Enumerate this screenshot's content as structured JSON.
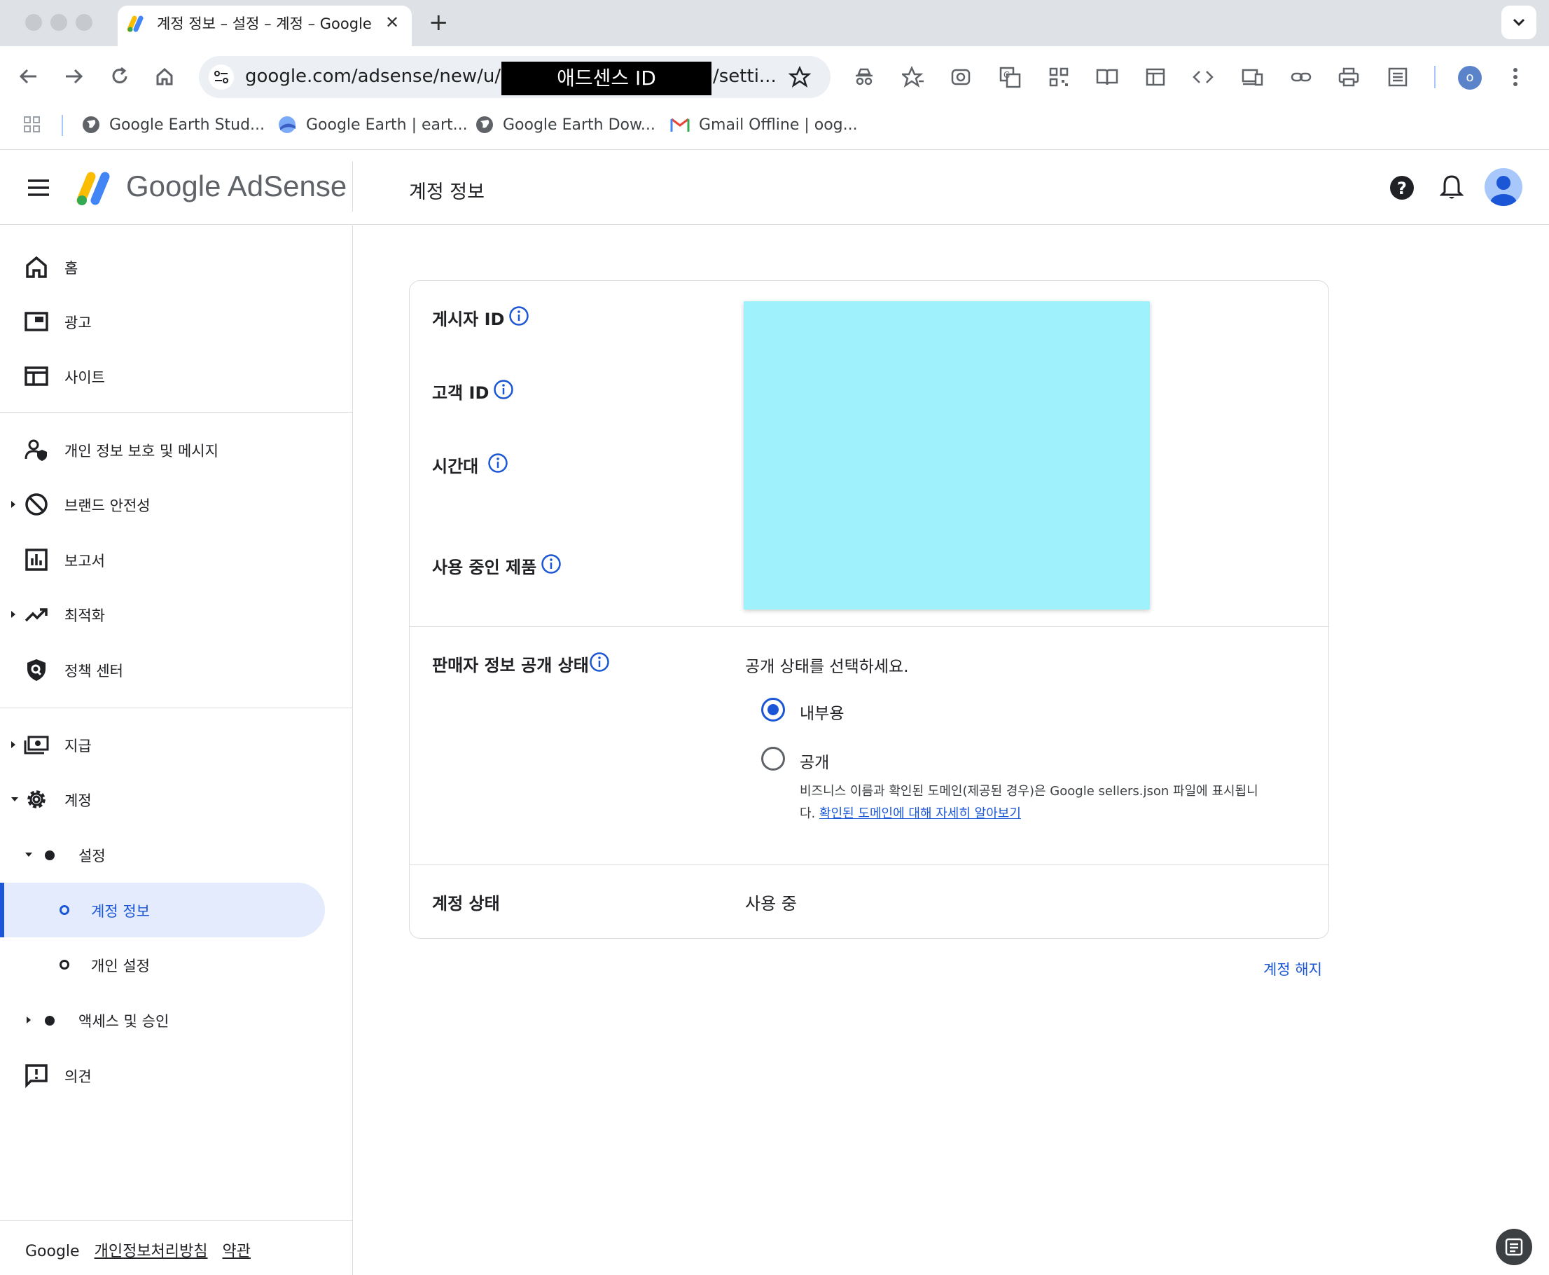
{
  "browser": {
    "tab_title": "계정 정보 – 설정 – 계정 – Google",
    "url_left": "google.com/adsense/new/u/0/",
    "url_redaction_label": "애드센스 ID",
    "url_right": "/setti...",
    "profile_initial": "o",
    "bookmarks": [
      {
        "label": "Google Earth Stud..."
      },
      {
        "label": "Google Earth | eart..."
      },
      {
        "label": "Google Earth Dow..."
      },
      {
        "label": "Gmail Offline | oog..."
      }
    ]
  },
  "header": {
    "logo_text": "Google AdSense",
    "page_title": "계정 정보"
  },
  "sidebar": {
    "items": [
      {
        "label": "홈"
      },
      {
        "label": "광고"
      },
      {
        "label": "사이트"
      },
      {
        "label": "개인 정보 보호 및 메시지"
      },
      {
        "label": "브랜드 안전성"
      },
      {
        "label": "보고서"
      },
      {
        "label": "최적화"
      },
      {
        "label": "정책 센터"
      },
      {
        "label": "지급"
      },
      {
        "label": "계정"
      },
      {
        "label": "설정"
      },
      {
        "label": "계정 정보"
      },
      {
        "label": "개인 설정"
      },
      {
        "label": "액세스 및 승인"
      },
      {
        "label": "의견"
      }
    ],
    "footer": {
      "google": "Google",
      "privacy": "개인정보처리방침",
      "terms": "약관"
    }
  },
  "card": {
    "publisher_id_label": "게시자 ID",
    "customer_id_label": "고객 ID",
    "timezone_label": "시간대",
    "products_label": "사용 중인 제품",
    "seller_visibility_label": "판매자 정보 공개 상태",
    "status_prompt": "공개 상태를 선택하세요.",
    "radio_internal": "내부용",
    "radio_public": "공개",
    "public_desc": "비즈니스 이름과 확인된 도메인(제공된 경우)은 Google sellers.json 파일에 표시됩니다.",
    "public_link": "확인된 도메인에 대해 자세히 알아보기",
    "account_status_label": "계정 상태",
    "account_status_value": "사용 중",
    "close_account": "계정 해지"
  },
  "colors": {
    "accent": "#1a56d6",
    "active_bg": "#e3ebfc",
    "redaction": "#9ff1fb"
  },
  "selected_visibility": "내부용"
}
